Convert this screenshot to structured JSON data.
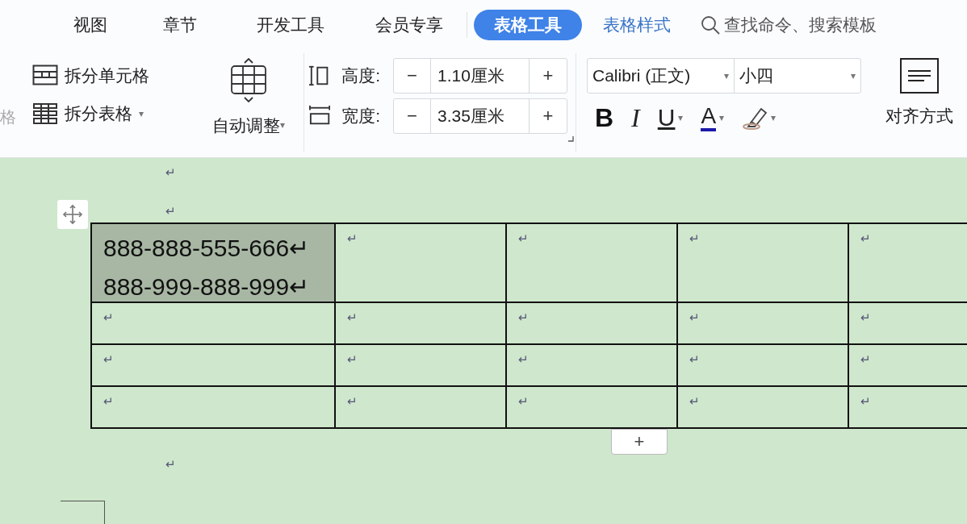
{
  "tabs": [
    {
      "label": "视图",
      "selected": false,
      "kind": "plain"
    },
    {
      "label": "章节",
      "selected": false,
      "kind": "plain"
    },
    {
      "label": "开发工具",
      "selected": false,
      "kind": "plain"
    },
    {
      "label": "会员专享",
      "selected": false,
      "kind": "plain"
    },
    {
      "label": "表格工具",
      "selected": true,
      "kind": "plain"
    },
    {
      "label": "表格样式",
      "selected": false,
      "kind": "context"
    }
  ],
  "search": {
    "placeholder": "查找命令、搜索模板"
  },
  "ribbon": {
    "cut_label": "格",
    "split_cell": "拆分单元格",
    "split_table": "拆分表格",
    "split_table_caret": "▾",
    "auto_fit": "自动调整",
    "auto_fit_caret": "▾",
    "height": {
      "label": "高度:",
      "minus": "−",
      "value": "1.10厘米",
      "plus": "+"
    },
    "width": {
      "label": "宽度:",
      "minus": "−",
      "value": "3.35厘米",
      "plus": "+"
    },
    "font": {
      "name": "Calibri (正文)",
      "size": "小四",
      "caret": "▾"
    },
    "format_buttons": [
      {
        "kind": "bold",
        "label": "B"
      },
      {
        "kind": "italic",
        "label": "I"
      },
      {
        "kind": "underline",
        "label": "U",
        "caret": "▾"
      },
      {
        "kind": "color",
        "label": "A",
        "caret": "▾",
        "color": "#1a1aa8"
      },
      {
        "kind": "highlight",
        "caret": "▾"
      }
    ],
    "align": "对齐方式"
  },
  "document": {
    "marks_before": [
      "↵",
      "↵"
    ],
    "table": {
      "rows": [
        {
          "cells": [
            {
              "lines": [
                "888-888-555-666↵",
                "888-999-888-999↵"
              ],
              "selected": true
            },
            {
              "lines": [
                "↵"
              ],
              "selected": false
            },
            {
              "lines": [
                "↵"
              ],
              "selected": false
            },
            {
              "lines": [
                "↵"
              ],
              "selected": false
            },
            {
              "lines": [
                "↵"
              ],
              "selected": false
            }
          ]
        },
        {
          "cells": [
            {
              "lines": [
                "↵"
              ],
              "selected": false
            },
            {
              "lines": [
                "↵"
              ],
              "selected": false
            },
            {
              "lines": [
                "↵"
              ],
              "selected": false
            },
            {
              "lines": [
                "↵"
              ],
              "selected": false
            },
            {
              "lines": [
                "↵"
              ],
              "selected": false
            }
          ]
        },
        {
          "cells": [
            {
              "lines": [
                "↵"
              ],
              "selected": false
            },
            {
              "lines": [
                "↵"
              ],
              "selected": false
            },
            {
              "lines": [
                "↵"
              ],
              "selected": false
            },
            {
              "lines": [
                "↵"
              ],
              "selected": false
            },
            {
              "lines": [
                "↵"
              ],
              "selected": false
            }
          ]
        },
        {
          "cells": [
            {
              "lines": [
                "↵"
              ],
              "selected": false
            },
            {
              "lines": [
                "↵"
              ],
              "selected": false
            },
            {
              "lines": [
                "↵"
              ],
              "selected": false
            },
            {
              "lines": [
                "↵"
              ],
              "selected": false
            },
            {
              "lines": [
                "↵"
              ],
              "selected": false
            }
          ]
        }
      ]
    },
    "add_row": "+",
    "marks_after": [
      "↵"
    ]
  }
}
